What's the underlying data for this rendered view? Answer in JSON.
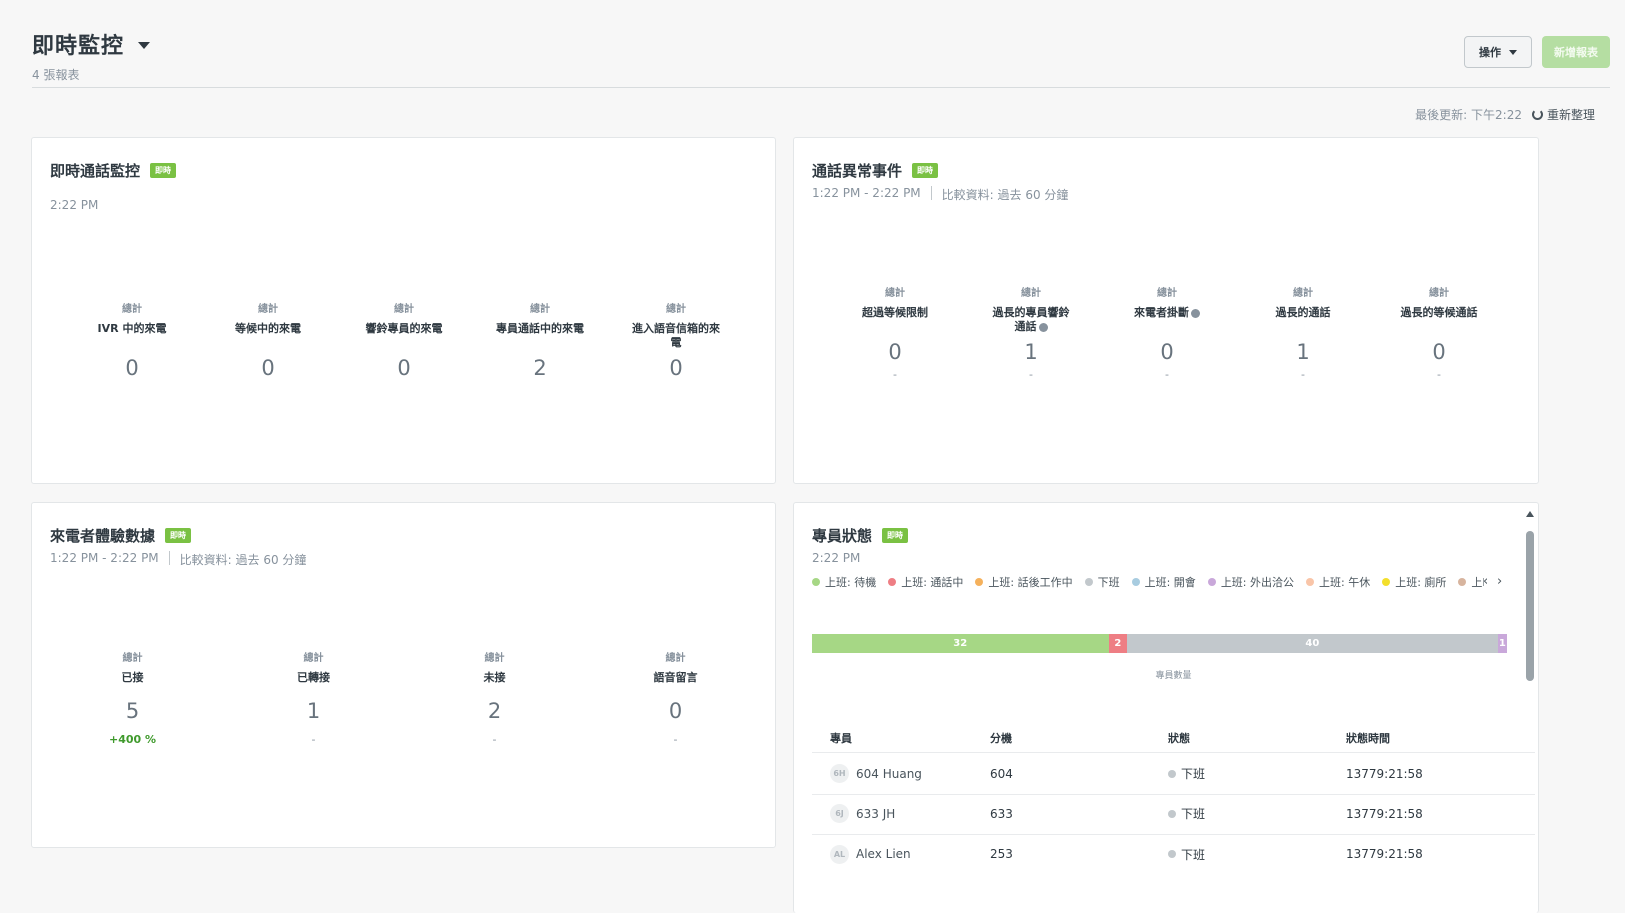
{
  "header": {
    "title": "即時監控",
    "subtitle": "4 張報表",
    "ops_label": "操作",
    "new_label": "新增報表"
  },
  "status": {
    "updated": "最後更新: 下午2:22",
    "refresh_label": "重新整理"
  },
  "live_badge": "即時",
  "cards": {
    "live_calls": {
      "title": "即時通話監控",
      "time": "2:22 PM",
      "metrics": [
        {
          "top": "總計",
          "label": "IVR 中的來電",
          "value": "0"
        },
        {
          "top": "總計",
          "label": "等候中的來電",
          "value": "0"
        },
        {
          "top": "總計",
          "label": "響鈴專員的來電",
          "value": "0"
        },
        {
          "top": "總計",
          "label": "專員通話中的來電",
          "value": "2"
        },
        {
          "top": "總計",
          "label": "進入語音信箱的來電",
          "value": "0"
        }
      ]
    },
    "anomalies": {
      "title": "通話異常事件",
      "time_range": "1:22 PM - 2:22 PM",
      "compare": "比較資料: 過去 60 分鐘",
      "metrics": [
        {
          "top": "總計",
          "label": "超過等候限制",
          "value": "0",
          "delta": "-"
        },
        {
          "top": "總計",
          "label": "過長的專員響鈴通話",
          "value": "1",
          "delta": "-"
        },
        {
          "top": "總計",
          "label": "來電者掛斷",
          "value": "0",
          "delta": "-"
        },
        {
          "top": "總計",
          "label": "過長的通話",
          "value": "1",
          "delta": "-"
        },
        {
          "top": "總計",
          "label": "過長的等候通話",
          "value": "0",
          "delta": "-"
        }
      ]
    },
    "experience": {
      "title": "來電者體驗數據",
      "time_range": "1:22 PM - 2:22 PM",
      "compare": "比較資料: 過去 60 分鐘",
      "metrics": [
        {
          "top": "總計",
          "label": "已接",
          "value": "5",
          "delta": "+400 %"
        },
        {
          "top": "總計",
          "label": "已轉接",
          "value": "1",
          "delta": "-"
        },
        {
          "top": "總計",
          "label": "未接",
          "value": "2",
          "delta": "-"
        },
        {
          "top": "總計",
          "label": "語音留言",
          "value": "0",
          "delta": "-"
        }
      ]
    },
    "agents": {
      "title": "專員狀態",
      "time": "2:22 PM",
      "legend": [
        {
          "label": "上班: 待機",
          "color": "#a6d785"
        },
        {
          "label": "上班: 通話中",
          "color": "#ee7e84"
        },
        {
          "label": "上班: 話後工作中",
          "color": "#f5b15c"
        },
        {
          "label": "下班",
          "color": "#c2c8cc"
        },
        {
          "label": "上班: 開會",
          "color": "#a8cce0"
        },
        {
          "label": "上班: 外出洽公",
          "color": "#c9a8da"
        },
        {
          "label": "上班: 午休",
          "color": "#f9c5a8"
        },
        {
          "label": "上班: 廁所",
          "color": "#f3df2c"
        },
        {
          "label": "上I",
          "color": "#d7b49e"
        }
      ],
      "bar": [
        {
          "value": 32,
          "color": "#a6d785"
        },
        {
          "value": 2,
          "color": "#ee7e84"
        },
        {
          "value": 40,
          "color": "#c2c8cc"
        },
        {
          "value": 1,
          "color": "#c9a8da"
        }
      ],
      "bar_caption": "專員數量",
      "columns": [
        "專員",
        "分機",
        "狀態",
        "狀態時間"
      ],
      "rows": [
        {
          "initials": "6H",
          "name": "604 Huang",
          "ext": "604",
          "status": "下班",
          "time": "13779:21:58"
        },
        {
          "initials": "6J",
          "name": "633 JH",
          "ext": "633",
          "status": "下班",
          "time": "13779:21:58"
        },
        {
          "initials": "AL",
          "name": "Alex Lien",
          "ext": "253",
          "status": "下班",
          "time": "13779:21:58"
        }
      ]
    }
  }
}
